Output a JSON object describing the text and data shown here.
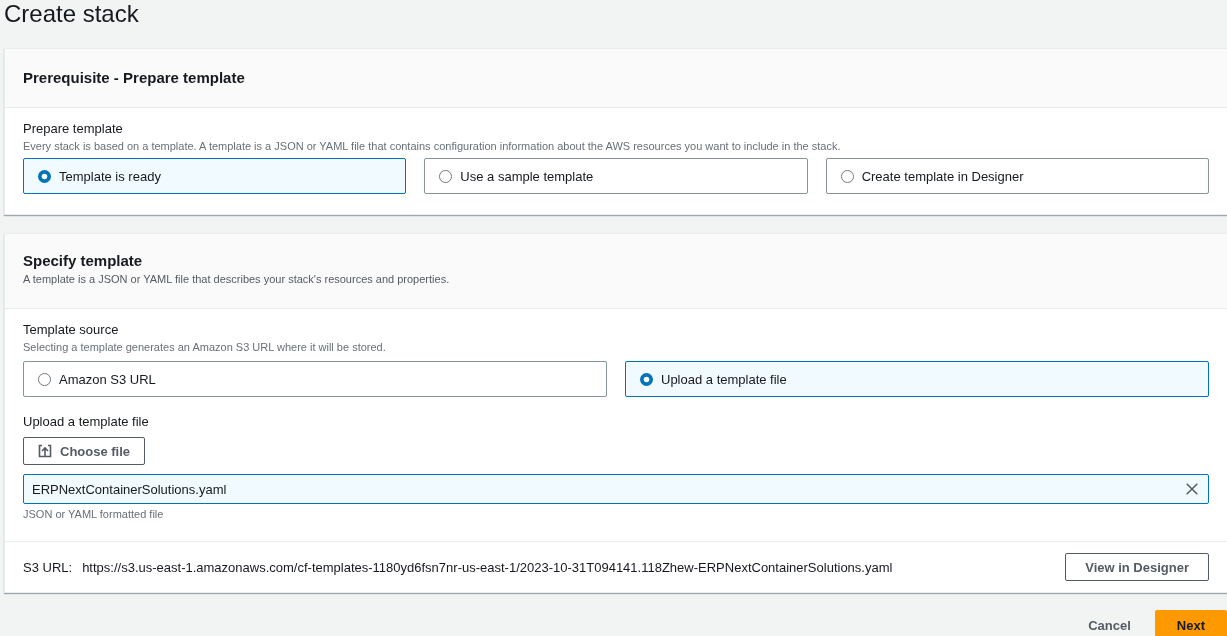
{
  "page_title": "Create stack",
  "prerequisite": {
    "heading": "Prerequisite - Prepare template",
    "prepare_template": {
      "label": "Prepare template",
      "description": "Every stack is based on a template. A template is a JSON or YAML file that contains configuration information about the AWS resources you want to include in the stack.",
      "options": [
        {
          "label": "Template is ready",
          "selected": true
        },
        {
          "label": "Use a sample template",
          "selected": false
        },
        {
          "label": "Create template in Designer",
          "selected": false
        }
      ]
    }
  },
  "specify_template": {
    "heading": "Specify template",
    "description": "A template is a JSON or YAML file that describes your stack's resources and properties.",
    "template_source": {
      "label": "Template source",
      "description": "Selecting a template generates an Amazon S3 URL where it will be stored.",
      "options": [
        {
          "label": "Amazon S3 URL",
          "selected": false
        },
        {
          "label": "Upload a template file",
          "selected": true
        }
      ]
    },
    "upload": {
      "label": "Upload a template file",
      "button": "Choose file",
      "value": "ERPNextContainerSolutions.yaml",
      "help": "JSON or YAML formatted file"
    },
    "s3_url": {
      "label": "S3 URL:",
      "value": "https://s3.us-east-1.amazonaws.com/cf-templates-1180yd6fsn7nr-us-east-1/2023-10-31T094141.118Zhew-ERPNextContainerSolutions.yaml",
      "button": "View in Designer"
    }
  },
  "actions": [
    {
      "label": "Cancel",
      "kind": "link"
    },
    {
      "label": "Next",
      "kind": "primary"
    }
  ]
}
